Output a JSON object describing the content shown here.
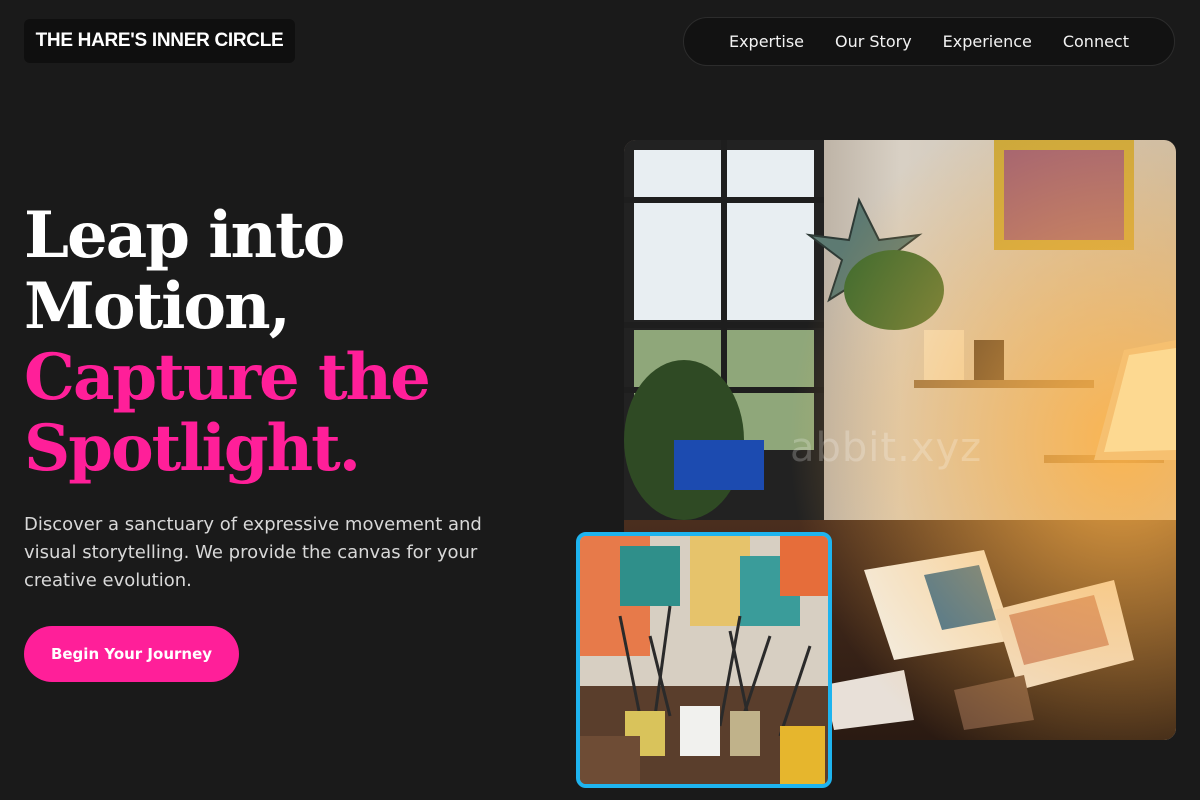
{
  "brand": {
    "logo_text": "THE HARE'S INNER CIRCLE"
  },
  "nav": {
    "items": [
      "Expertise",
      "Our Story",
      "Experience",
      "Connect"
    ]
  },
  "hero": {
    "headline_white": [
      "Leap into",
      "Motion,"
    ],
    "headline_pink": [
      "Capture the",
      "Spotlight."
    ],
    "subtext": "Discover a sanctuary of expressive movement and visual storytelling. We provide the canvas for your creative evolution.",
    "cta_label": "Begin Your Journey"
  },
  "images": {
    "main_alt": "artist studio with plants, sketchbooks and lamp",
    "inset_alt": "cans filled with paint brushes"
  },
  "watermark": "abbit.xyz",
  "colors": {
    "background": "#1a1a1a",
    "accent": "#ff1f99",
    "inset_border": "#1eb4ef"
  }
}
